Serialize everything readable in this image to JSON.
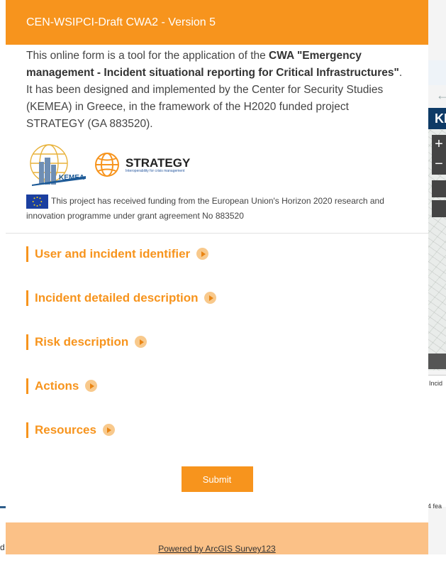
{
  "background_app": {
    "title_fragment": "KE",
    "zoom_in": "+",
    "zoom_out": "−",
    "table_tab_fragment": "Incid",
    "features_fragment": "4 fea",
    "bottom_left_fragment": "d"
  },
  "survey": {
    "title": "CEN-WSIPCI-Draft CWA2 - Version 5",
    "intro_text_1": "This online form is a tool for the application of the ",
    "intro_bold": "CWA \"Emergency management - Incident situational reporting for Critical Infrastructures\"",
    "intro_text_2": ". It has been designed and implemented by the Center for Security Studies (KEMEA) in Greece, in the framework of the H2020 funded project STRATEGY (GA 883520).",
    "logo_kemea_text": "KEMEA",
    "logo_strategy_text": "STRATEGY",
    "logo_strategy_sub": "Interoperability for crisis management",
    "eu_funding_text": "This project has received funding from the European Union's Horizon 2020 research and innovation programme under grant agreement No 883520",
    "sections": [
      {
        "label": "User and incident identifier"
      },
      {
        "label": "Incident detailed description"
      },
      {
        "label": "Risk description"
      },
      {
        "label": "Actions"
      },
      {
        "label": "Resources"
      }
    ],
    "submit_label": "Submit",
    "footer_link": "Powered by ArcGIS Survey123"
  },
  "colors": {
    "accent": "#f7941d",
    "footer_bg": "#fbc187"
  }
}
